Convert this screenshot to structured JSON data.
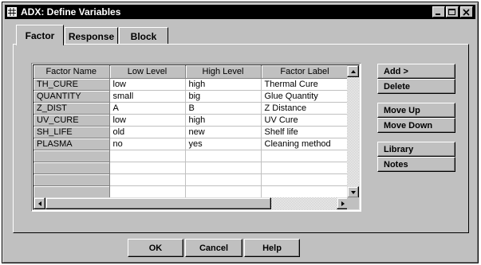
{
  "window": {
    "title": "ADX: Define Variables",
    "icons": {
      "app": "table-app-icon",
      "minimize": "minimize-icon",
      "maximize": "maximize-icon",
      "close": "close-icon"
    }
  },
  "tabs": [
    {
      "label": "Factor",
      "active": true
    },
    {
      "label": "Response",
      "active": false
    },
    {
      "label": "Block",
      "active": false
    }
  ],
  "grid": {
    "columns": [
      "Factor Name",
      "Low Level",
      "High Level",
      "Factor Label"
    ],
    "rows": [
      [
        "TH_CURE",
        "low",
        "high",
        "Thermal Cure"
      ],
      [
        "QUANTITY",
        "small",
        "big",
        "Glue Quantity"
      ],
      [
        "Z_DIST",
        "A",
        "B",
        "Z Distance"
      ],
      [
        "UV_CURE",
        "low",
        "high",
        "UV Cure"
      ],
      [
        "SH_LIFE",
        "old",
        "new",
        "Shelf life"
      ],
      [
        "PLASMA",
        "no",
        "yes",
        "Cleaning method"
      ]
    ],
    "empty_rows": 4
  },
  "side_buttons": {
    "add": "Add >",
    "delete": "Delete",
    "move_up": "Move Up",
    "move_down": "Move Down",
    "library": "Library",
    "notes": "Notes"
  },
  "bottom_buttons": {
    "ok": "OK",
    "cancel": "Cancel",
    "help": "Help"
  }
}
